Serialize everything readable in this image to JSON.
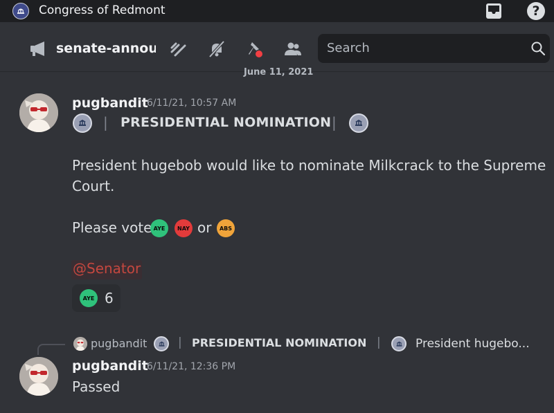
{
  "app": {
    "server_name": "Congress of Redmont"
  },
  "channel": {
    "name": "senate-announ",
    "search_placeholder": "Search"
  },
  "date_divider": "June 11, 2021",
  "messages": [
    {
      "username": "pugbandit",
      "timestamp": "6/11/21, 10:57 AM",
      "title": "PRESIDENTIAL NOMINATION",
      "separator": "|",
      "body_line1": "President hugebob would like to nominate Milkcrack to the Supreme",
      "body_line2": "Court.",
      "vote_prefix": "Please vote",
      "vote_or": "or",
      "votes": {
        "aye": "AYE",
        "nay": "NAY",
        "abs": "ABS"
      },
      "mention": "@Senator",
      "reaction": {
        "label": "AYE",
        "count": "6"
      }
    },
    {
      "reply": {
        "username": "pugbandit",
        "title": "PRESIDENTIAL NOMINATION",
        "separator": "|",
        "preview": "President hugebo..."
      },
      "username": "pugbandit",
      "timestamp": "6/11/21, 12:36 PM",
      "body": "Passed"
    }
  ],
  "colors": {
    "background": "#313338",
    "titlebar": "#1e1f22",
    "aye": "#2fc27b",
    "nay": "#e23b3b",
    "abs": "#f0a43a",
    "mention": "#c4473f"
  },
  "icons": [
    "capitol-icon",
    "inbox-icon",
    "help-icon",
    "megaphone-icon",
    "threads-icon",
    "mute-icon",
    "pin-icon",
    "members-icon",
    "search-icon",
    "government-emblem-icon"
  ]
}
